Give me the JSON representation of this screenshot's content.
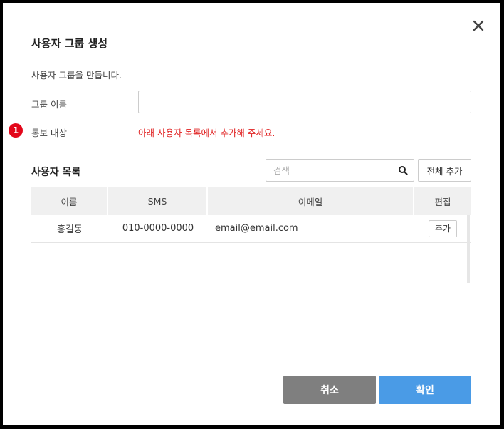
{
  "dialog": {
    "title": "사용자 그룹 생성",
    "description": "사용자 그룹을 만듭니다.",
    "close_icon": "close-icon"
  },
  "form": {
    "group_name_label": "그룹 이름",
    "group_name_value": "",
    "badge_number": "1",
    "notify_label": "통보 대상",
    "notify_warning": "아래 사용자 목록에서 추가해 주세요."
  },
  "user_list": {
    "title": "사용자 목록",
    "search_placeholder": "검색",
    "add_all_label": "전체 추가",
    "columns": [
      "이름",
      "SMS",
      "이메일",
      "편집"
    ],
    "rows": [
      {
        "name": "홍길동",
        "sms": "010-0000-0000",
        "email": "email@email.com",
        "action": "추가"
      }
    ]
  },
  "footer": {
    "cancel_label": "취소",
    "confirm_label": "확인"
  },
  "colors": {
    "warning": "#e02020",
    "badge": "#e3061a",
    "confirm": "#4a9be6",
    "cancel": "#7f7f7f"
  }
}
